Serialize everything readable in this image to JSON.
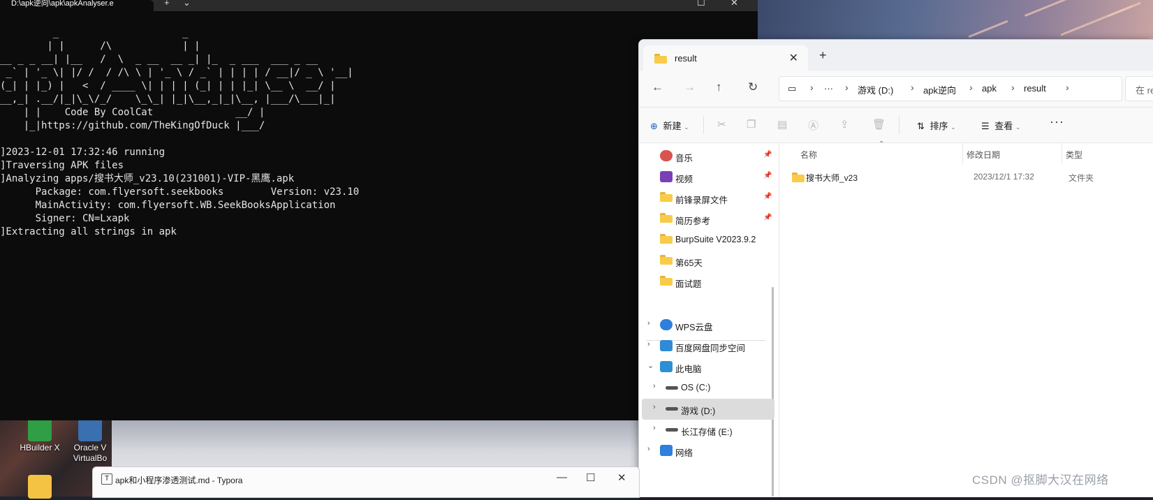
{
  "terminal": {
    "tab_title": "D:\\apk逆向\\apk\\apkAnalyser.e",
    "new_tab": "+",
    "dropdown": "⌄",
    "maximize": "☐",
    "close": "✕",
    "lines": [
      "         _                     _",
      "        | |      /\\            | |",
      "__ _ _ __| |__   /  \\  _ __  __ _| |_  _ ___  ___ _ __",
      " _` | '_ \\| |/ /  / /\\ \\ | '_ \\ / _` | | | | / __|/ _ \\ '__|",
      "(_| | |_) |   <  / ____ \\| | | | (_| | | |_| \\__ \\  __/ |",
      "__,_| .__/|_|\\_\\/_/    \\_\\_| |_|\\__,_|_|\\__, |___/\\___|_|",
      "    | |    Code By CoolCat              __/ |",
      "    |_|https://github.com/TheKingOfDuck |___/",
      "",
      "]2023-12-01 17:32:46 running",
      "]Traversing APK files",
      "]Analyzing apps/搜书大师_v23.10(231001)-VIP-黑鹰.apk",
      "      Package: com.flyersoft.seekbooks        Version: v23.10",
      "      MainActivity: com.flyersoft.WB.SeekBooksApplication",
      "      Signer: CN=Lxapk",
      "]Extracting all strings in apk"
    ]
  },
  "desktop": {
    "icons": [
      {
        "label": "HBuilder X"
      },
      {
        "label_line1": "Oracle V",
        "label_line2": "VirtualBo"
      }
    ]
  },
  "explorer": {
    "tab_title": "result",
    "tab_close": "✕",
    "new_tab": "+",
    "breadcrumb": [
      "游戏 (D:)",
      "apk逆向",
      "apk",
      "result"
    ],
    "breadcrumb_more": "···",
    "search_placeholder": "在 re",
    "toolbar": {
      "new_label": "新建",
      "sort_label": "排序",
      "view_label": "查看",
      "more": "···"
    },
    "nav": {
      "quick_access": [
        {
          "label": "音乐",
          "pinned": true,
          "icon": "music-icon"
        },
        {
          "label": "视频",
          "pinned": true,
          "icon": "video-icon"
        },
        {
          "label": "前锋录屏文件",
          "pinned": true,
          "icon": "folder-icon"
        },
        {
          "label": "简历参考",
          "pinned": true,
          "icon": "folder-icon"
        },
        {
          "label": "BurpSuite V2023.9.2",
          "pinned": false,
          "icon": "folder-icon"
        },
        {
          "label": "第65天",
          "pinned": false,
          "icon": "folder-icon"
        },
        {
          "label": "面试题",
          "pinned": false,
          "icon": "folder-icon"
        }
      ],
      "tree": [
        {
          "label": "WPS云盘",
          "icon": "cloud-icon"
        },
        {
          "label": "百度网盘同步空间",
          "icon": "baidu-icon"
        },
        {
          "label": "此电脑",
          "icon": "pc-icon"
        },
        {
          "label": "OS (C:)",
          "icon": "drive-icon"
        },
        {
          "label": "游戏 (D:)",
          "icon": "drive-icon"
        },
        {
          "label": "长江存储 (E:)",
          "icon": "drive-icon"
        },
        {
          "label": "网络",
          "icon": "network-icon"
        }
      ]
    },
    "columns": {
      "name": "名称",
      "date": "修改日期",
      "type": "类型"
    },
    "rows": [
      {
        "name": "搜书大师_v23",
        "date": "2023/12/1 17:32",
        "type": "文件夹"
      }
    ]
  },
  "typora": {
    "title": "apk和小程序渗透测试.md - Typora",
    "logo": "T",
    "minimize": "—",
    "maximize": "☐",
    "close": "✕"
  },
  "watermark": "CSDN @抠脚大汉在网络"
}
